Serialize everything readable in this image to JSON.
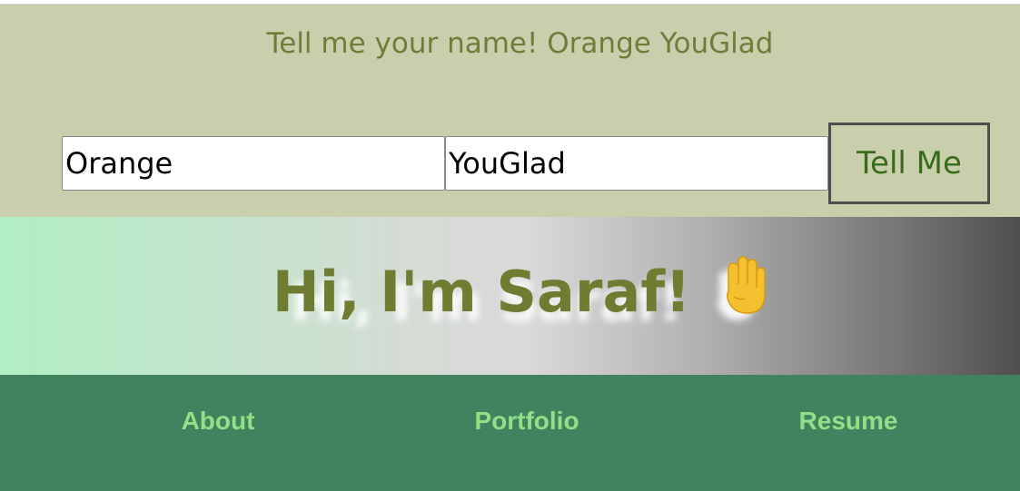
{
  "form": {
    "greeting": "Tell me your name! Orange YouGlad",
    "first_name_value": "Orange",
    "last_name_value": "YouGlad",
    "submit_label": "Tell Me"
  },
  "hero": {
    "title": "Hi, I'm Saraf!",
    "emoji_icon": "waving-hand-icon"
  },
  "nav": {
    "links": [
      {
        "label": "About"
      },
      {
        "label": "Portfolio"
      },
      {
        "label": "Resume"
      }
    ]
  },
  "colors": {
    "form_background": "#c9cfad",
    "greeting_text": "#6f7d3a",
    "button_text": "#3a6b1c",
    "hero_title": "#6f7d32",
    "hero_gradient_start": "#b0eec3",
    "hero_gradient_end": "#4f4f4f",
    "nav_background": "#43825f",
    "nav_link": "#8fe086"
  }
}
